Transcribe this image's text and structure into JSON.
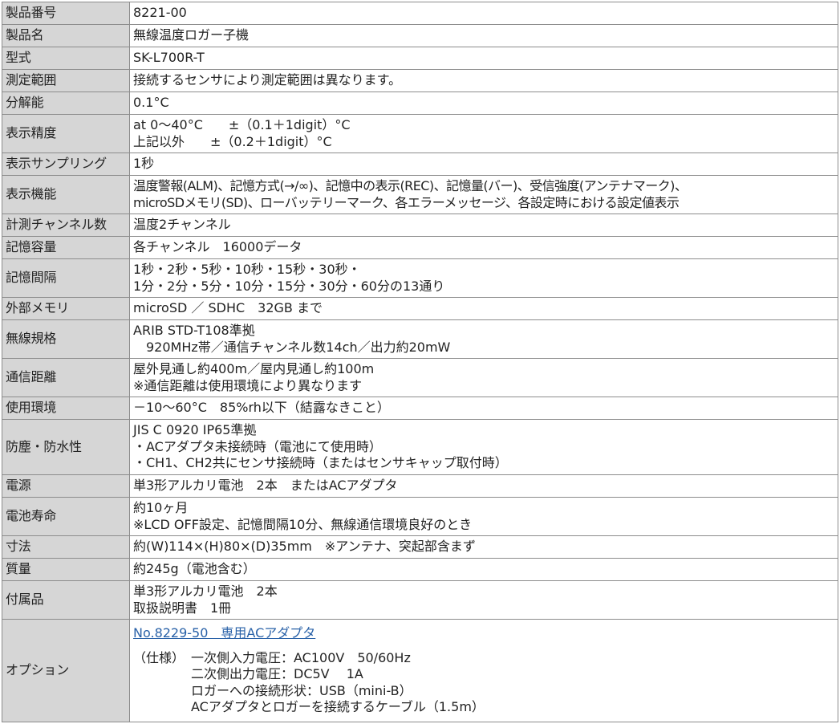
{
  "rows": [
    {
      "label": "製品番号",
      "lines": [
        "8221-00"
      ]
    },
    {
      "label": "製品名",
      "lines": [
        "無線温度ロガー子機"
      ]
    },
    {
      "label": "型式",
      "lines": [
        "SK-L700R-T"
      ]
    },
    {
      "label": "測定範囲",
      "lines": [
        "接続するセンサにより測定範囲は異なります。"
      ]
    },
    {
      "label": "分解能",
      "lines": [
        "0.1°C"
      ]
    },
    {
      "label": "表示精度",
      "lines": [
        "at 0～40°C　　±（0.1＋1digit）°C",
        "上記以外　　±（0.2＋1digit）°C"
      ]
    },
    {
      "label": "表示サンプリング",
      "lines": [
        "1秒"
      ]
    },
    {
      "label": "表示機能",
      "lines": [
        "温度警報(ALM)、記憶方式(→/∞)、記憶中の表示(REC)、記憶量(バー)、受信強度(アンテナマーク)、",
        "microSDメモリ(SD)、ローバッテリーマーク、各エラーメッセージ、各設定時における設定値表示"
      ]
    },
    {
      "label": "計測チャンネル数",
      "lines": [
        "温度2チャンネル"
      ]
    },
    {
      "label": "記憶容量",
      "lines": [
        "各チャンネル　16000データ"
      ]
    },
    {
      "label": "記憶間隔",
      "lines": [
        "1秒・2秒・5秒・10秒・15秒・30秒・",
        "1分・2分・5分・10分・15分・30分・60分の13通り"
      ]
    },
    {
      "label": "外部メモリ",
      "lines": [
        "microSD ／ SDHC　32GB まで"
      ]
    },
    {
      "label": "無線規格",
      "lines": [
        "ARIB STD-T108準拠",
        "　920MHz帯／通信チャンネル数14ch／出力約20mW"
      ]
    },
    {
      "label": "通信距離",
      "lines": [
        "屋外見通し約400m／屋内見通し約100m",
        "※通信距離は使用環境により異なります"
      ]
    },
    {
      "label": "使用環境",
      "lines": [
        "－10～60°C　85%rh以下（結露なきこと）"
      ]
    },
    {
      "label": "防塵・防水性",
      "lines": [
        "JIS C 0920 IP65準拠",
        "・ACアダプタ未接続時（電池にて使用時）",
        "・CH1、CH2共にセンサ接続時（またはセンサキャップ取付時）"
      ]
    },
    {
      "label": "電源",
      "lines": [
        "単3形アルカリ電池　2本　またはACアダプタ"
      ]
    },
    {
      "label": "電池寿命",
      "lines": [
        "約10ヶ月",
        "※LCD OFF設定、記憶間隔10分、無線通信環境良好のとき"
      ]
    },
    {
      "label": "寸法",
      "lines": [
        "約(W)114×(H)80×(D)35mm　※アンテナ、突起部含まず"
      ]
    },
    {
      "label": "質量",
      "lines": [
        "約245g（電池含む）"
      ]
    },
    {
      "label": "付属品",
      "lines": [
        "単3形アルカリ電池　2本",
        "取扱説明書　1冊"
      ]
    }
  ],
  "option": {
    "label": "オプション",
    "link_text": "No.8229-50　専用ACアダプタ",
    "spec_head": "（仕様）",
    "spec_lines": [
      "一次側入力電圧：AC100V　50/60Hz",
      "二次側出力電圧：DC5V　 1A",
      "ロガーへの接続形状：USB（mini-B）",
      "ACアダプタとロガーを接続するケーブル（1.5m）"
    ]
  },
  "colors": {
    "label_bg": "#d6d6d6",
    "border": "#8c8c8c",
    "link": "#2a62a8"
  }
}
